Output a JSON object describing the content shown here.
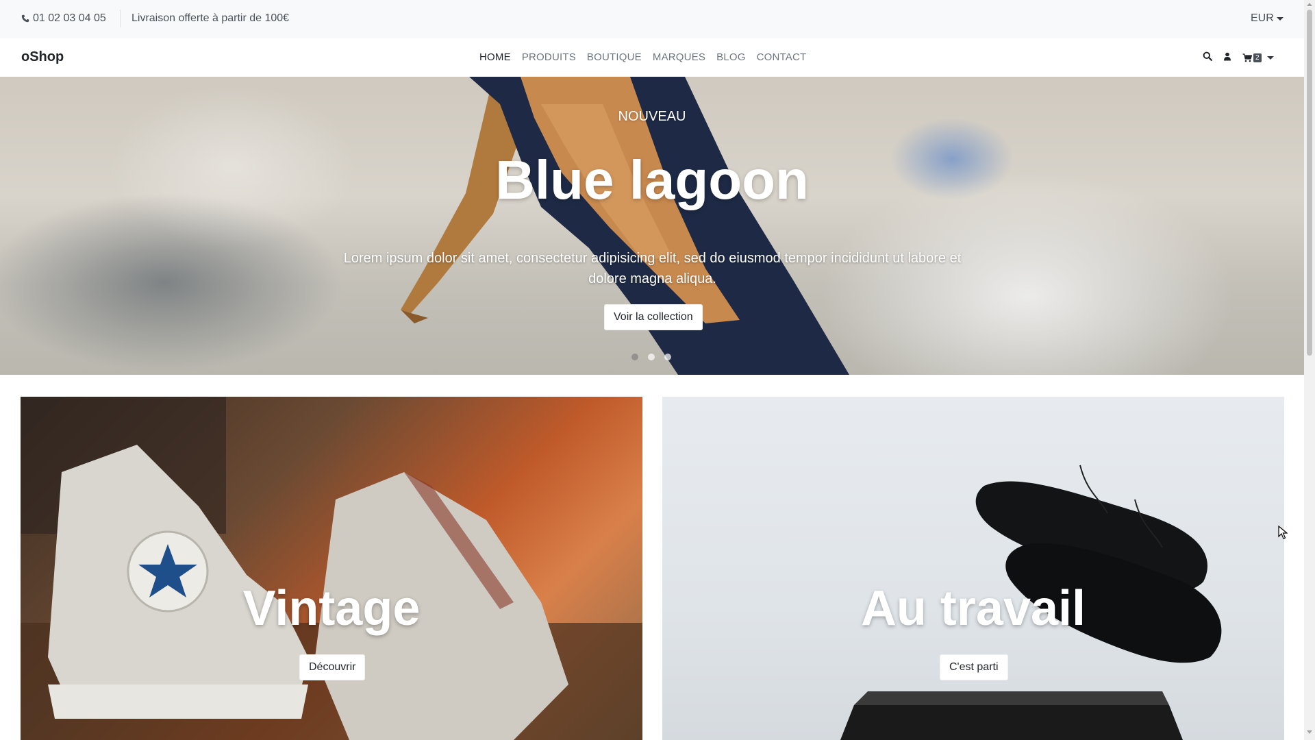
{
  "topbar": {
    "phone": "01 02 03 04 05",
    "shipping": "Livraison offerte à partir de 100€",
    "currency": "EUR"
  },
  "navbar": {
    "brand": "oShop",
    "links": [
      "HOME",
      "PRODUITS",
      "BOUTIQUE",
      "MARQUES",
      "BLOG",
      "CONTACT"
    ],
    "active_link": "HOME",
    "icons": [
      "search-icon",
      "user-icon",
      "cart-icon"
    ],
    "cart_count": "2"
  },
  "hero": {
    "kicker": "NOUVEAU",
    "title": "Blue lagoon",
    "text": "Lorem ipsum dolor sit amet, consectetur adipisicing elit, sed do eiusmod tempor incididunt ut labore et dolore magna aliqua.",
    "button": "Voir la collection",
    "slides": 3,
    "active_slide": 1
  },
  "categories": [
    {
      "title": "Vintage",
      "button": "Découvrir"
    },
    {
      "title": "Au travail",
      "button": "C'est parti"
    }
  ],
  "colors": {
    "topbar_bg": "#f8f9fa",
    "text_dark": "#212529",
    "text_muted": "#6c757d"
  }
}
